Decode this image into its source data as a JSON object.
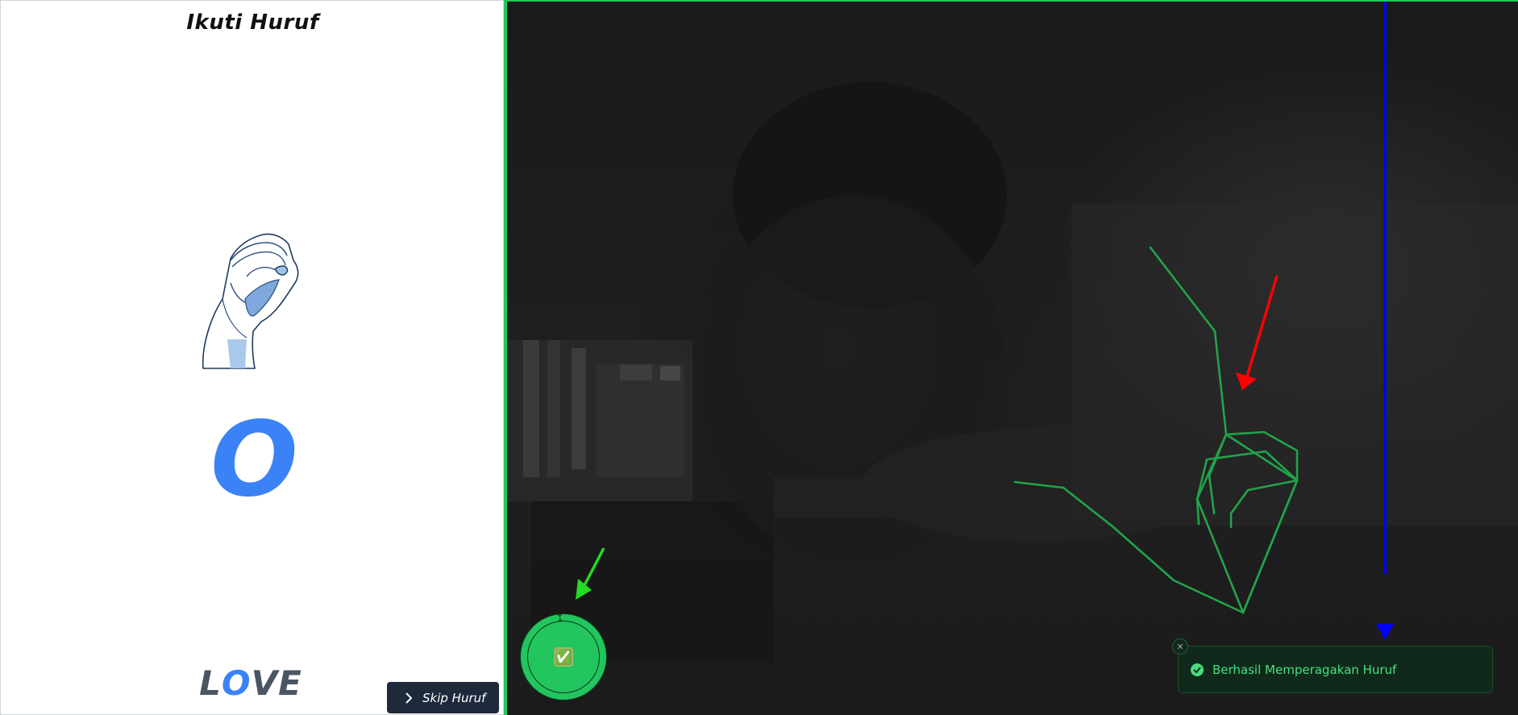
{
  "instruction_panel": {
    "title": "Ikuti Huruf",
    "current_letter": "O",
    "word_letters": [
      {
        "char": "L",
        "color": "#4b5563"
      },
      {
        "char": "O",
        "color": "#3b82f6"
      },
      {
        "char": "V",
        "color": "#4b5563"
      },
      {
        "char": "E",
        "color": "#4b5563"
      }
    ],
    "skip_button_label": "Skip Huruf"
  },
  "camera": {
    "progress_check": "✅",
    "progress_fraction": 0.97
  },
  "toast": {
    "message": "Berhasil Memperagakan Huruf",
    "close_symbol": "✕"
  },
  "colors": {
    "accent_green": "#22c55e",
    "letter_blue": "#3b82f6",
    "toast_text": "#4ade80",
    "arrow_red": "#ff0000",
    "arrow_green": "#22dd22",
    "arrow_blue": "#0000ff"
  }
}
